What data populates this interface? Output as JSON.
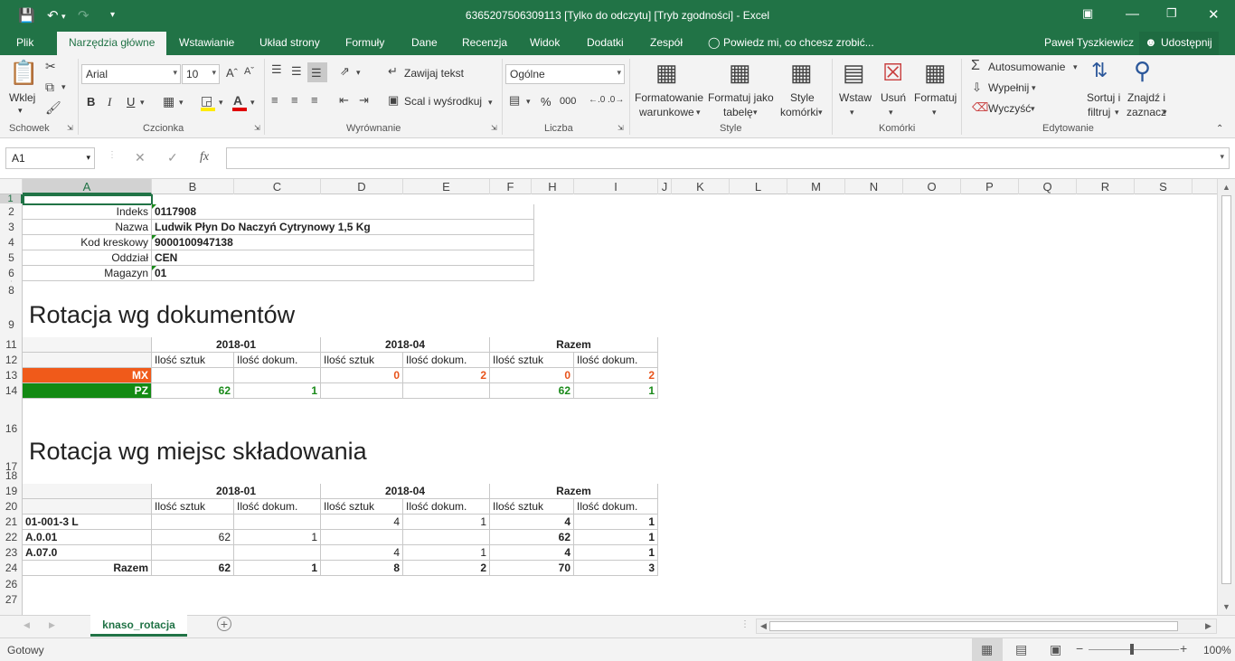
{
  "window": {
    "title": "6365207506309113  [Tylko do odczytu]  [Tryb zgodności] - Excel",
    "user": "Paweł Tyszkiewicz",
    "share": "Udostępnij"
  },
  "tabs": [
    "Plik",
    "Narzędzia główne",
    "Wstawianie",
    "Układ strony",
    "Formuły",
    "Dane",
    "Recenzja",
    "Widok",
    "Dodatki",
    "Zespół"
  ],
  "tell_me": "Powiedz mi, co chcesz zrobić...",
  "ribbon": {
    "groups": [
      "Schowek",
      "Czcionka",
      "Wyrównanie",
      "Liczba",
      "Style",
      "Komórki",
      "Edytowanie"
    ],
    "paste": "Wklej",
    "font_name": "Arial",
    "font_size": "10",
    "wrap_text": "Zawijaj tekst",
    "merge_center": "Scal i wyśrodkuj",
    "number_format": "Ogólne",
    "cond_format_1": "Formatowanie",
    "cond_format_2": "warunkowe",
    "format_table_1": "Formatuj jako",
    "format_table_2": "tabelę",
    "cell_styles_1": "Style",
    "cell_styles_2": "komórki",
    "insert": "Wstaw",
    "delete": "Usuń",
    "format": "Formatuj",
    "autosum": "Autosumowanie",
    "fill": "Wypełnij",
    "clear": "Wyczyść",
    "sort_1": "Sortuj i",
    "sort_2": "filtruj",
    "find_1": "Znajdź i",
    "find_2": "zaznacz",
    "bold": "B",
    "italic": "I",
    "underline": "U",
    "percent": "%",
    "thousands": "000",
    "fx": "fx"
  },
  "name_box": "A1",
  "columns": [
    "A",
    "B",
    "C",
    "D",
    "E",
    "F",
    "H",
    "I",
    "J",
    "K",
    "L",
    "M",
    "N",
    "O",
    "P",
    "Q",
    "R",
    "S"
  ],
  "rows": [
    "1",
    "2",
    "3",
    "4",
    "5",
    "6",
    "7",
    "8",
    "9",
    "11",
    "12",
    "13",
    "14",
    "16",
    "17",
    "18",
    "19",
    "20",
    "21",
    "22",
    "23",
    "24",
    "26",
    "27"
  ],
  "info": [
    {
      "label": "Indeks",
      "value": "0117908"
    },
    {
      "label": "Nazwa",
      "value": "Ludwik Płyn Do Naczyń Cytrynowy 1,5 Kg"
    },
    {
      "label": "Kod kreskowy",
      "value": "9000100947138"
    },
    {
      "label": "Oddział",
      "value": "CEN"
    },
    {
      "label": "Magazyn",
      "value": "01"
    }
  ],
  "section1": {
    "title": "Rotacja wg dokumentów",
    "periods": [
      "2018-01",
      "2018-04",
      "Razem"
    ],
    "subheaders": [
      "Ilość sztuk",
      "Ilość dokum.",
      "Ilość sztuk",
      "Ilość dokum.",
      "Ilość sztuk",
      "Ilość dokum."
    ],
    "rows": [
      {
        "label": "MX",
        "cells": [
          "",
          "",
          "0",
          "2",
          "0",
          "2"
        ],
        "color": "#e8541c"
      },
      {
        "label": "PZ",
        "cells": [
          "62",
          "1",
          "",
          "",
          "62",
          "1"
        ],
        "color": "#1a8a1a"
      }
    ]
  },
  "section2": {
    "title": "Rotacja wg miejsc składowania",
    "periods": [
      "2018-01",
      "2018-04",
      "Razem"
    ],
    "subheaders": [
      "Ilość sztuk",
      "Ilość dokum.",
      "Ilość sztuk",
      "Ilość dokum.",
      "Ilość sztuk",
      "Ilość dokum."
    ],
    "rows": [
      {
        "label": "01-001-3 L",
        "cells": [
          "",
          "",
          "4",
          "1",
          "4",
          "1"
        ]
      },
      {
        "label": "A.0.01",
        "cells": [
          "62",
          "1",
          "",
          "",
          "62",
          "1"
        ]
      },
      {
        "label": "A.07.0",
        "cells": [
          "",
          "",
          "4",
          "1",
          "4",
          "1"
        ]
      },
      {
        "label": "Razem",
        "cells": [
          "62",
          "1",
          "8",
          "2",
          "70",
          "3"
        ]
      }
    ]
  },
  "sheet_tab": "knaso_rotacja",
  "status": "Gotowy",
  "zoom": "100%"
}
